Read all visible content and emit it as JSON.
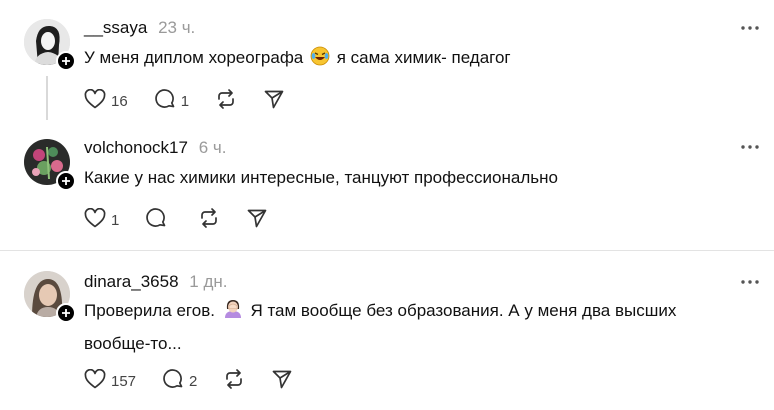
{
  "comments": [
    {
      "username": "__ssaya",
      "time": "23 ч.",
      "text_before": "У меня диплом хореографа",
      "emoji": "😂",
      "text_after": "я сама химик- педагог",
      "likes": "16",
      "replies": "1"
    },
    {
      "username": "volchonock17",
      "time": "6 ч.",
      "text": "Какие у нас химики интересные, танцуют профессионально",
      "likes": "1",
      "replies": ""
    },
    {
      "username": "dinara_3658",
      "time": "1 дн.",
      "text_before": "Проверила егов.",
      "emoji": "🤦‍♀️",
      "text_after": "Я там вообще без образования. А у меня два высших вообще-то...",
      "likes": "157",
      "replies": "2"
    }
  ],
  "icons": {
    "like": "heart-icon",
    "reply": "comment-icon",
    "repost": "repost-icon",
    "share": "send-icon",
    "more": "more-dots-icon",
    "follow": "plus-icon"
  }
}
